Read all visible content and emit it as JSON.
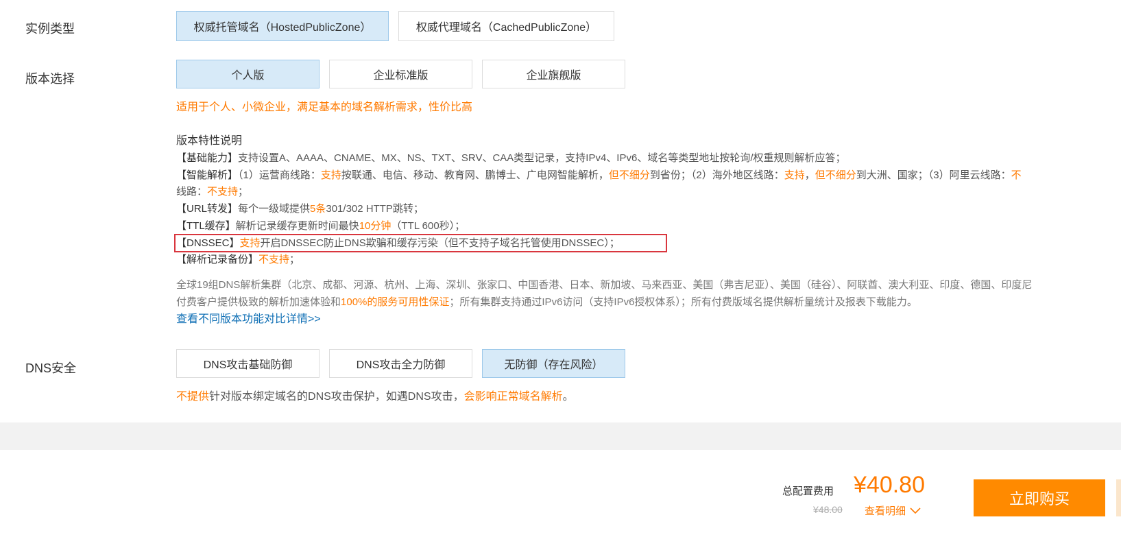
{
  "instance_type": {
    "label": "实例类型",
    "options": [
      "权威托管域名（HostedPublicZone）",
      "权威代理域名（CachedPublicZone）"
    ],
    "selected": 0
  },
  "version": {
    "label": "版本选择",
    "options": [
      "个人版",
      "企业标准版",
      "企业旗舰版"
    ],
    "selected": 0,
    "tagline": "适用于个人、小微企业，满足基本的域名解析需求，性价比高",
    "features_title": "版本特性说明",
    "features": {
      "basic": {
        "head": "【基础能力】",
        "text": "支持设置A、AAAA、CNAME、MX、NS、TXT、SRV、CAA类型记录，支持IPv4、IPv6、域名等类型地址按轮询/权重规则解析应答；"
      },
      "smart": {
        "head": "【智能解析】",
        "p1": "（1）运营商线路：",
        "o1": "支持",
        "p2": "按联通、电信、移动、教育网、鹏博士、广电网智能解析，",
        "o2": "但不细分",
        "p3": "到省份；（2）海外地区线路：",
        "o3": "支持",
        "p4": "，",
        "o4": "但不细分",
        "p5": "到大洲、国家；（3）阿里云线路：",
        "o5": "不",
        "cont": "线路：",
        "o6": "不支持",
        "end": "；"
      },
      "url": {
        "head": "【URL转发】",
        "p1": "每个一级域提供",
        "o1": "5条",
        "p2": "301/302 HTTP跳转；"
      },
      "ttl": {
        "head": "【TTL缓存】",
        "p1": "解析记录缓存更新时间最快",
        "o1": "10分钟",
        "p2": "（TTL 600秒）；"
      },
      "dnssec": {
        "head": "【DNSSEC】",
        "o1": "支持",
        "p1": "开启DNSSEC防止DNS欺骗和缓存污染（但不支持子域名托管使用DNSSEC）；"
      },
      "backup": {
        "head": "【解析记录备份】",
        "o1": "不支持",
        "p1": "；"
      }
    },
    "clusters_line1": "全球19组DNS解析集群（北京、成都、河源、杭州、上海、深圳、张家口、中国香港、日本、新加坡、马来西亚、美国（弗吉尼亚）、美国（硅谷）、阿联酋、澳大利亚、印度、德国、印度尼",
    "clusters_line2_a": "付费客户提供极致的解析加速体验和",
    "clusters_line2_o": "100%的服务可用性保证",
    "clusters_line2_b": "；所有集群支持通过IPv6访问（支持IPv6授权体系）；所有付费版域名提供解析量统计及报表下载能力。",
    "compare_link": "查看不同版本功能对比详情>>"
  },
  "dns_security": {
    "label": "DNS安全",
    "options": [
      "DNS攻击基础防御",
      "DNS攻击全力防御",
      "无防御（存在风险）"
    ],
    "selected": 2,
    "note_o1": "不提供",
    "note_p1": "针对版本绑定域名的DNS攻击保护，如遇DNS攻击，",
    "note_o2": "会影响正常域名解析",
    "note_p2": "。"
  },
  "footer": {
    "total_label": "总配置费用",
    "price": "¥40.80",
    "original_price": "¥48.00",
    "detail_link": "查看明细",
    "buy_button": "立即购买"
  },
  "colors": {
    "accent": "#ff7a00",
    "selected_bg": "#d7eaf8",
    "link": "#0f6fb5",
    "highlight_box": "#d9363e",
    "buy_button": "#ff8a00"
  }
}
